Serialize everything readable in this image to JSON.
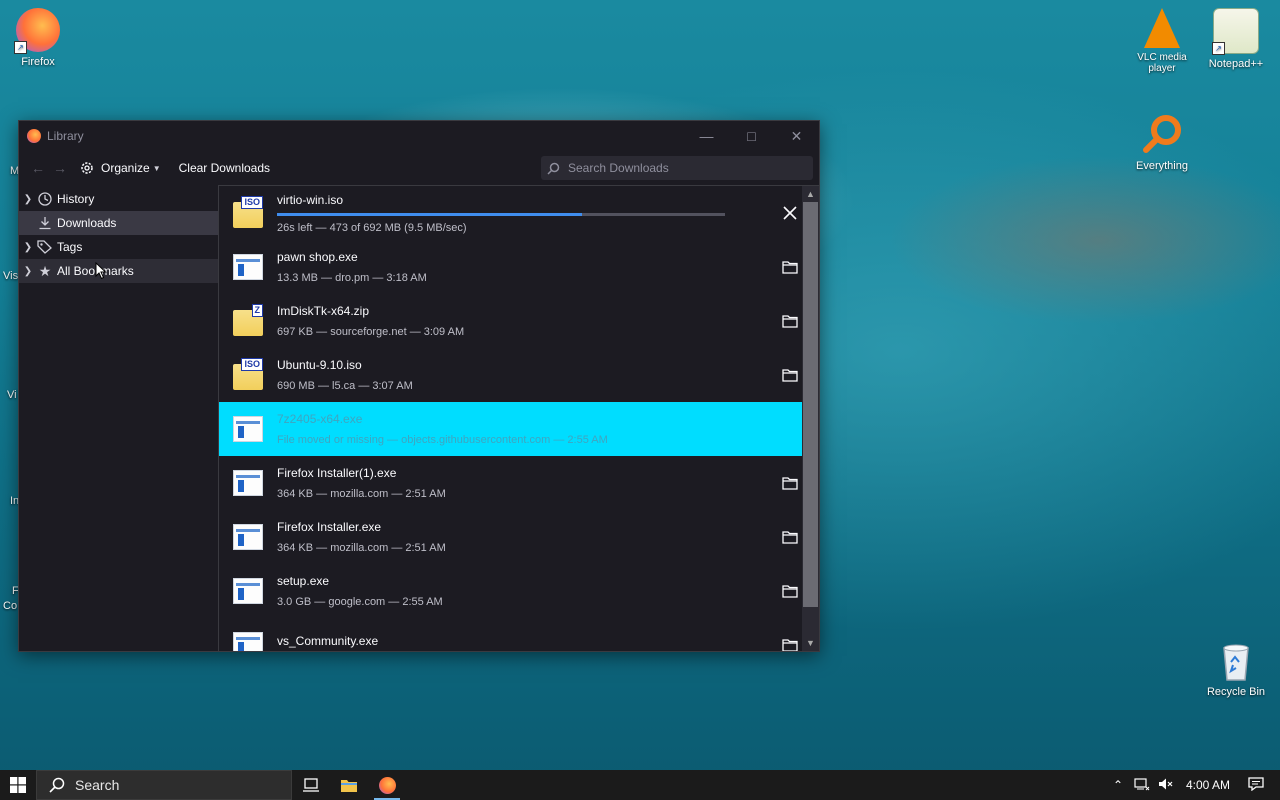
{
  "desktop": {
    "icons": {
      "firefox": "Firefox",
      "vlc": "VLC media player",
      "notepad": "Notepad++",
      "everything": "Everything",
      "recycle": "Recycle Bin"
    },
    "edge_labels": [
      "M",
      "Vis",
      "Vi",
      "In",
      "F",
      "Co"
    ]
  },
  "window": {
    "title": "Library",
    "toolbar": {
      "organize": "Organize",
      "clear_downloads": "Clear Downloads",
      "search_placeholder": "Search Downloads"
    },
    "sidebar": [
      {
        "label": "History"
      },
      {
        "label": "Downloads"
      },
      {
        "label": "Tags"
      },
      {
        "label": "All Bookmarks"
      }
    ],
    "downloads": [
      {
        "name": "virtio-win.iso",
        "meta": "26s left — 473 of 692 MB (9.5 MB/sec)",
        "progress": 0.68,
        "icon": "iso-icon"
      },
      {
        "name": "pawn shop.exe",
        "meta": "13.3 MB — dro.pm — 3:18 AM",
        "icon": "exe-icon"
      },
      {
        "name": "ImDiskTk-x64.zip",
        "meta": "697 KB — sourceforge.net — 3:09 AM",
        "icon": "zip-icon"
      },
      {
        "name": "Ubuntu-9.10.iso",
        "meta": "690 MB — l5.ca — 3:07 AM",
        "icon": "iso-icon"
      },
      {
        "name": "7z2405-x64.exe",
        "meta": "File moved or missing — objects.githubusercontent.com — 2:55 AM",
        "icon": "exe-icon"
      },
      {
        "name": "Firefox Installer(1).exe",
        "meta": "364 KB — mozilla.com — 2:51 AM",
        "icon": "exe-icon"
      },
      {
        "name": "Firefox Installer.exe",
        "meta": "364 KB — mozilla.com — 2:51 AM",
        "icon": "exe-icon"
      },
      {
        "name": "setup.exe",
        "meta": "3.0 GB — google.com — 2:55 AM",
        "icon": "exe-icon"
      },
      {
        "name": "vs_Community.exe",
        "meta": "",
        "icon": "exe-icon"
      }
    ]
  },
  "taskbar": {
    "search": "Search",
    "clock": "4:00 AM"
  }
}
